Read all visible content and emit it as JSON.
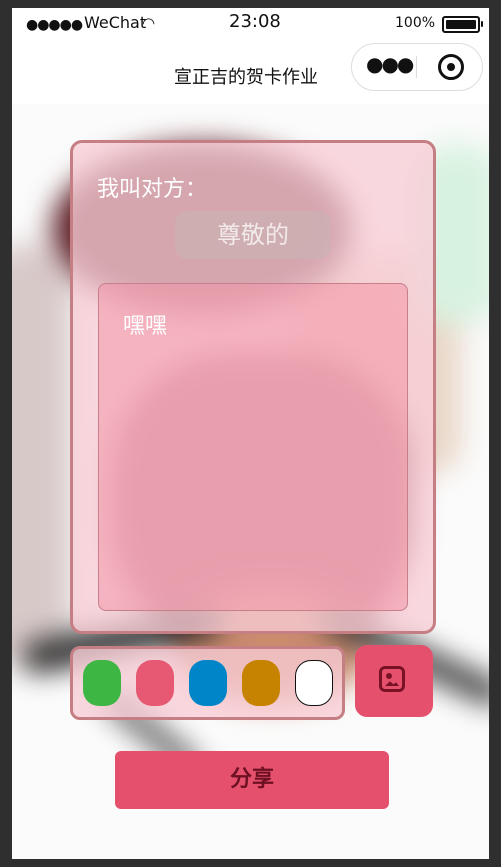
{
  "status_bar": {
    "signal": "●●●●●",
    "carrier": "WeChat",
    "time": "23:08",
    "battery_percent": "100%",
    "icons": [
      "wifi-icon",
      "battery-icon"
    ]
  },
  "nav": {
    "title": "宣正吉的贺卡作业",
    "capsule_icons": [
      "more-icon",
      "close-target-icon"
    ]
  },
  "card": {
    "label": "我叫对方：",
    "nickname_value": "尊敬的",
    "message_value": "嘿嘿"
  },
  "palette": {
    "colors": [
      "#3db643",
      "#e75872",
      "#0085c8",
      "#c68300",
      "#ffffff"
    ]
  },
  "image_button": {
    "icon": "image-icon"
  },
  "share_button": {
    "label": "分享"
  }
}
